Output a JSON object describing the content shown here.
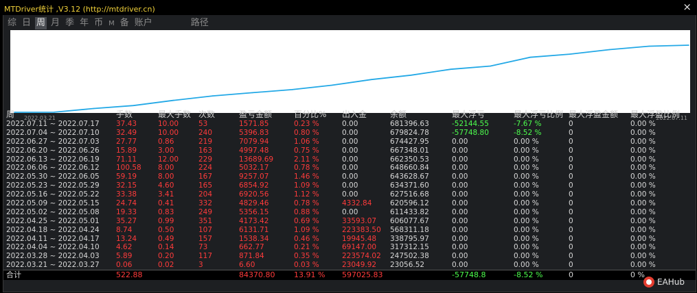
{
  "window": {
    "title": "MTDriver统计 ,V3.12 (http://mtdriver.cn)",
    "close": "×"
  },
  "tabs": [
    {
      "label": "综",
      "active": false,
      "small": false
    },
    {
      "label": "日",
      "active": false,
      "small": false
    },
    {
      "label": "周",
      "active": true,
      "small": false
    },
    {
      "label": "月",
      "active": false,
      "small": false
    },
    {
      "label": "季",
      "active": false,
      "small": false
    },
    {
      "label": "年",
      "active": false,
      "small": false
    },
    {
      "label": "币",
      "active": false,
      "small": false
    },
    {
      "label": "M",
      "active": false,
      "small": true
    },
    {
      "label": "备",
      "active": false,
      "small": false
    },
    {
      "label": "账户",
      "active": false,
      "small": false
    },
    {
      "label": "路径",
      "active": false,
      "small": false,
      "path": true
    }
  ],
  "chart_data": {
    "type": "line",
    "x_start_label": "2022.03.21",
    "x_end_label": "2022.07.11",
    "line_color": "#22a8e6",
    "series": [
      {
        "values": [
          0.0,
          0.06,
          5.95,
          10.57,
          18.57,
          25.69,
          30.69,
          35.52,
          42.45,
          51.31,
          58.16,
          67.42,
          72.45,
          86.14,
          91.14,
          98.22,
          103.62,
          105.19
        ]
      }
    ],
    "y_unit": "balance growth (approx)"
  },
  "table": {
    "columns": [
      "周",
      "手数",
      "最大手数",
      "次数",
      "盈亏金额",
      "百分比%",
      "出入金",
      "余额",
      "最大浮亏",
      "最大浮亏比例",
      "最大浮盈金额",
      "最大浮盈比例"
    ],
    "rows": [
      [
        "2022.07.11 ~ 2022.07.17",
        "37.43",
        "10.00",
        "53",
        "1571.85",
        "0.23 %",
        "0.00",
        "681396.63",
        "-52144.55",
        "-7.67 %",
        "0",
        "0.00 %"
      ],
      [
        "2022.07.04 ~ 2022.07.10",
        "32.49",
        "10.00",
        "240",
        "5396.83",
        "0.80 %",
        "0.00",
        "679824.78",
        "-57748.80",
        "-8.52 %",
        "0",
        "0.00 %"
      ],
      [
        "2022.06.27 ~ 2022.07.03",
        "27.77",
        "0.86",
        "219",
        "7079.94",
        "1.06 %",
        "0.00",
        "674427.95",
        "0.00",
        "0.00 %",
        "0",
        "0.00 %"
      ],
      [
        "2022.06.20 ~ 2022.06.26",
        "15.89",
        "3.00",
        "163",
        "4997.48",
        "0.75 %",
        "0.00",
        "667348.01",
        "0.00",
        "0.00 %",
        "0",
        "0.00 %"
      ],
      [
        "2022.06.13 ~ 2022.06.19",
        "71.11",
        "12.00",
        "229",
        "13689.69",
        "2.11 %",
        "0.00",
        "662350.53",
        "0.00",
        "0.00 %",
        "0",
        "0.00 %"
      ],
      [
        "2022.06.06 ~ 2022.06.12",
        "100.58",
        "8.00",
        "224",
        "5032.17",
        "0.78 %",
        "0.00",
        "648660.84",
        "0.00",
        "0.00 %",
        "0",
        "0.00 %"
      ],
      [
        "2022.05.30 ~ 2022.06.05",
        "59.19",
        "8.00",
        "167",
        "9257.07",
        "1.46 %",
        "0.00",
        "643628.67",
        "0.00",
        "0.00 %",
        "0",
        "0.00 %"
      ],
      [
        "2022.05.23 ~ 2022.05.29",
        "32.15",
        "4.60",
        "165",
        "6854.92",
        "1.09 %",
        "0.00",
        "634371.60",
        "0.00",
        "0.00 %",
        "0",
        "0.00 %"
      ],
      [
        "2022.05.16 ~ 2022.05.22",
        "33.38",
        "3.41",
        "204",
        "6920.56",
        "1.12 %",
        "0.00",
        "627516.68",
        "0.00",
        "0.00 %",
        "0",
        "0.00 %"
      ],
      [
        "2022.05.09 ~ 2022.05.15",
        "24.74",
        "0.41",
        "332",
        "4829.46",
        "0.78 %",
        "4332.84",
        "620596.12",
        "0.00",
        "0.00 %",
        "0",
        "0.00 %"
      ],
      [
        "2022.05.02 ~ 2022.05.08",
        "19.33",
        "0.83",
        "249",
        "5356.15",
        "0.88 %",
        "0.00",
        "611433.82",
        "0.00",
        "0.00 %",
        "0",
        "0.00 %"
      ],
      [
        "2022.04.25 ~ 2022.05.01",
        "35.27",
        "0.99",
        "351",
        "4173.42",
        "0.69 %",
        "33593.07",
        "606077.67",
        "0.00",
        "0.00 %",
        "0",
        "0.00 %"
      ],
      [
        "2022.04.18 ~ 2022.04.24",
        "8.74",
        "0.50",
        "107",
        "6131.71",
        "1.09 %",
        "223383.50",
        "568311.18",
        "0.00",
        "0.00 %",
        "0",
        "0.00 %"
      ],
      [
        "2022.04.11 ~ 2022.04.17",
        "13.24",
        "0.49",
        "157",
        "1538.34",
        "0.46 %",
        "19945.48",
        "338795.97",
        "0.00",
        "0.00 %",
        "0",
        "0.00 %"
      ],
      [
        "2022.04.04 ~ 2022.04.10",
        "4.62",
        "0.14",
        "73",
        "662.77",
        "0.21 %",
        "69147.00",
        "317312.15",
        "0.00",
        "0.00 %",
        "0",
        "0.00 %"
      ],
      [
        "2022.03.28 ~ 2022.04.03",
        "5.89",
        "0.20",
        "117",
        "871.84",
        "0.35 %",
        "223574.02",
        "247502.38",
        "0.00",
        "0.00 %",
        "0",
        "0.00 %"
      ],
      [
        "2022.03.21 ~ 2022.03.27",
        "0.06",
        "0.02",
        "3",
        "6.60",
        "0.03 %",
        "23049.92",
        "23056.52",
        "0.00",
        "0.00 %",
        "0",
        "0.00 %"
      ]
    ],
    "total": [
      "合计",
      "522.88",
      "",
      "",
      "84370.80",
      "13.91 %",
      "597025.83",
      "",
      "-57748.8",
      "-8.52 %",
      "0",
      "0 %"
    ]
  },
  "brand": {
    "label": "EAHub"
  },
  "colors": {
    "positive": "#ff3b3b",
    "negative": "#4dff4d",
    "neutral": "#d8d8d8",
    "title": "#f2d23a",
    "line": "#22a8e6"
  }
}
